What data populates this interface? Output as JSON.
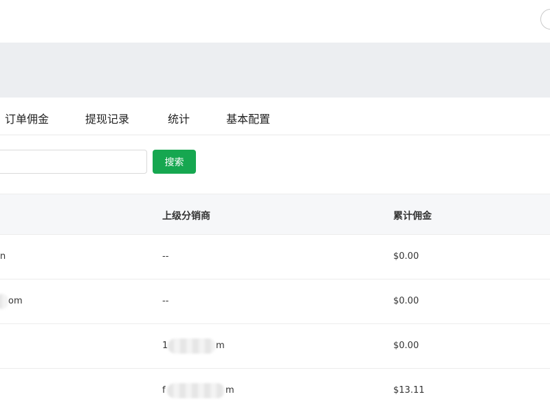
{
  "tabs": [
    {
      "label": "订单佣金"
    },
    {
      "label": "提现记录"
    },
    {
      "label": "统计"
    },
    {
      "label": "基本配置"
    }
  ],
  "search": {
    "placeholder": "",
    "value": "",
    "button_label": "搜索"
  },
  "table": {
    "columns": [
      "上级分销商",
      "累计佣金"
    ],
    "rows": [
      {
        "col0": "n",
        "parent": "--",
        "commission": "$0.00"
      },
      {
        "col0": "om",
        "parent": "--",
        "commission": "$0.00"
      },
      {
        "col0": "",
        "parent_prefix": "1",
        "parent_suffix": "m",
        "commission": "$0.00"
      },
      {
        "col0": "",
        "parent_prefix": "f",
        "parent_suffix": "m",
        "commission": "$13.11"
      }
    ]
  },
  "colors": {
    "accent": "#16a750",
    "header_band": "#eceef1",
    "table_header": "#f6f7f9"
  }
}
